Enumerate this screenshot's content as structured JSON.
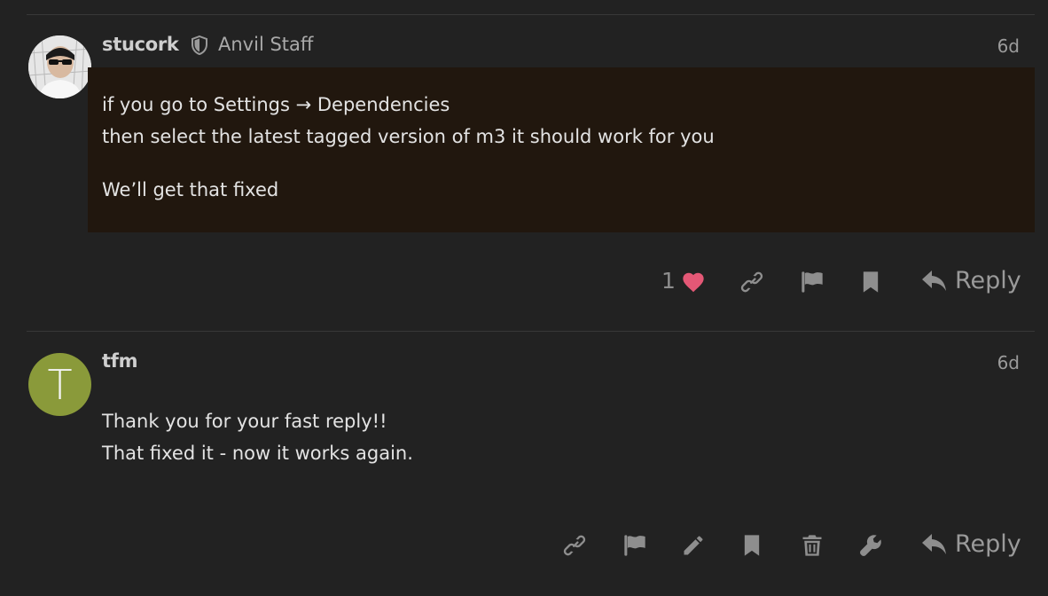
{
  "posts": [
    {
      "username": "stucork",
      "user_title": "Anvil Staff",
      "date": "6d",
      "paragraphs": [
        "if you go to Settings → Dependencies",
        "then select the latest tagged version of m3 it should work for you",
        "We’ll get that fixed"
      ],
      "like_count": "1",
      "reply_label": "Reply",
      "icons": [
        "shield-icon",
        "heart-icon",
        "link-icon",
        "flag-icon",
        "bookmark-icon",
        "reply-icon"
      ],
      "colors": {
        "highlight": "#21170e",
        "heart": "#e45876"
      }
    },
    {
      "username": "tfm",
      "avatar_letter": "T",
      "date": "6d",
      "paragraphs": [
        "Thank you for your fast reply!!",
        "That fixed it - now it works again."
      ],
      "reply_label": "Reply",
      "icons": [
        "link-icon",
        "flag-icon",
        "pencil-icon",
        "bookmark-icon",
        "trash-icon",
        "wrench-icon",
        "reply-icon"
      ],
      "colors": {
        "avatar": "#8a9a3a"
      }
    }
  ]
}
